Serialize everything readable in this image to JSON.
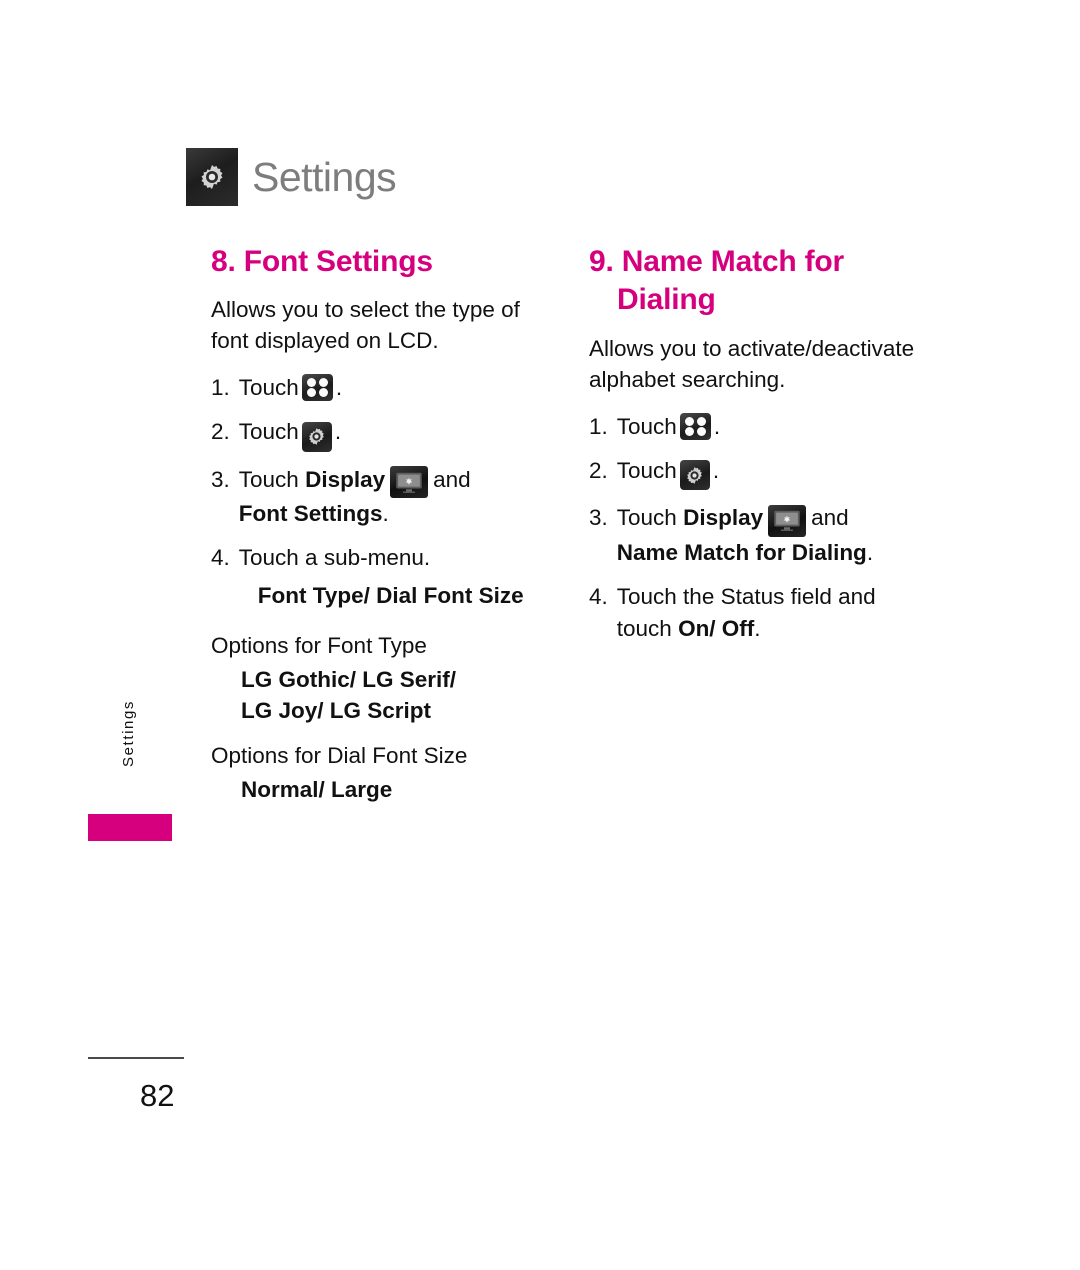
{
  "header": {
    "title": "Settings",
    "icon": "gear-icon"
  },
  "sections": [
    {
      "number_title": "8. Font Settings",
      "title_line1": "8. Font Settings",
      "title_line2": "",
      "intro": "Allows you to select the type of font displayed on LCD.",
      "steps": [
        {
          "num": "1.",
          "text_before": "Touch",
          "icon": "grid-icon",
          "text_after": "."
        },
        {
          "num": "2.",
          "text_before": "Touch",
          "icon": "gear-icon",
          "text_after": "."
        },
        {
          "num": "3.",
          "text_before": "Touch",
          "bold_before": "Display",
          "icon": "display-icon",
          "text_after": "and",
          "sub_bold": "Font Settings",
          "sub_after": "."
        },
        {
          "num": "4.",
          "text_before": "Touch a sub-menu.",
          "sub_bold": "Font Type/ Dial Font Size",
          "sub_after": ""
        }
      ],
      "options": [
        {
          "label": "Options for Font Type",
          "values_line1": "LG Gothic/ LG Serif/",
          "values_line2": "LG Joy/ LG Script"
        },
        {
          "label": "Options for Dial Font Size",
          "values_line1": "Normal/ Large",
          "values_line2": ""
        }
      ]
    },
    {
      "number_title": "9. Name Match for Dialing",
      "title_line1": "9. Name Match for",
      "title_line2": "Dialing",
      "intro": "Allows you to activate/deactivate alphabet searching.",
      "steps": [
        {
          "num": "1.",
          "text_before": "Touch",
          "icon": "grid-icon",
          "text_after": "."
        },
        {
          "num": "2.",
          "text_before": "Touch",
          "icon": "gear-icon",
          "text_after": "."
        },
        {
          "num": "3.",
          "text_before": "Touch",
          "bold_before": "Display",
          "icon": "display-icon",
          "text_after": "and",
          "sub_bold": "Name Match for Dialing",
          "sub_after": "."
        },
        {
          "num": "4.",
          "text_before": "Touch the Status field and",
          "sub_plain": "touch ",
          "sub_bold": "On/ Off",
          "sub_after": "."
        }
      ],
      "options": []
    }
  ],
  "side_tab": {
    "label": "Settings",
    "bar_color": "#d6007f"
  },
  "footer": {
    "page_number": "82"
  },
  "colors": {
    "accent_magenta": "#d6007f",
    "header_gray": "#7d7d7d",
    "body_black": "#111111",
    "icon_dark": "#1c1c1c"
  }
}
